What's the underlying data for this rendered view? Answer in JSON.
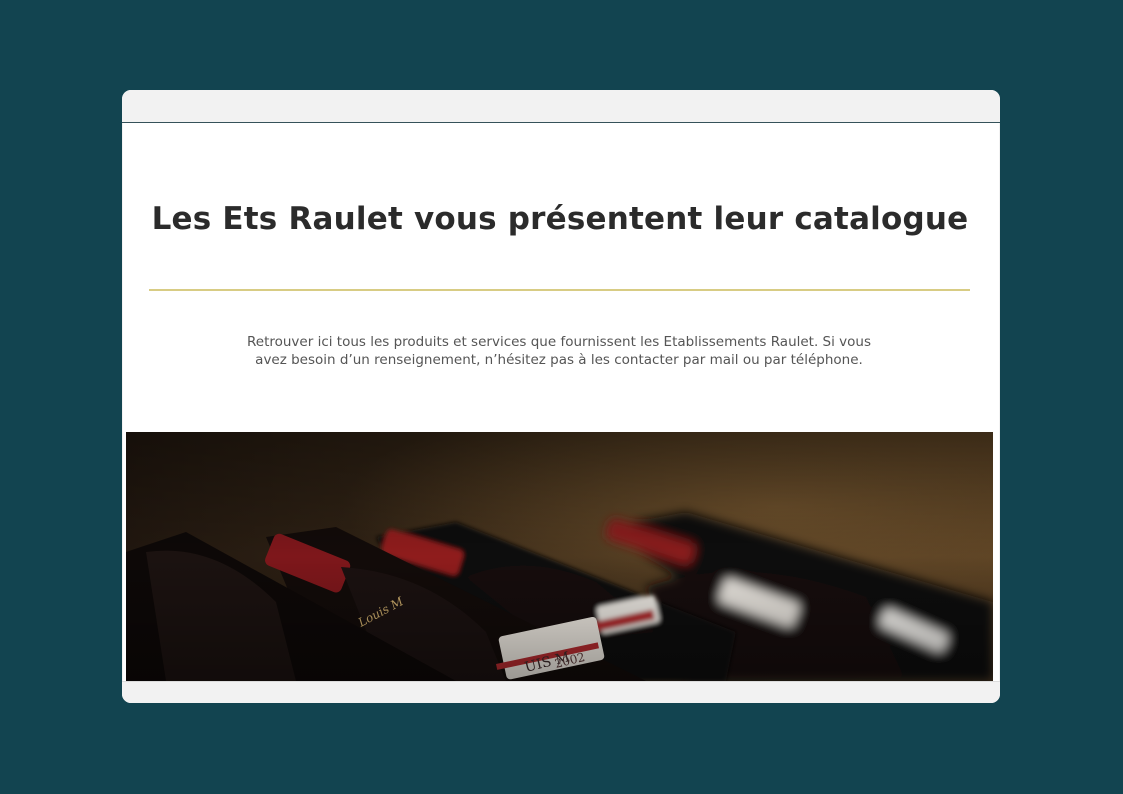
{
  "page": {
    "title": "Les Ets Raulet vous présentent leur catalogue",
    "description": "Retrouver ici tous les produits et services que fournissent  les Etablissements Raulet. Si vous avez besoin d’un renseignement, n’hésitez pas à les contacter par mail ou par téléphone."
  },
  "hero_image": {
    "subject": "wine-bottles-photo"
  },
  "colors": {
    "background": "#124450",
    "accent_rule": "#d8cc84",
    "title_text": "#2b2b2b",
    "body_text": "#555555"
  }
}
